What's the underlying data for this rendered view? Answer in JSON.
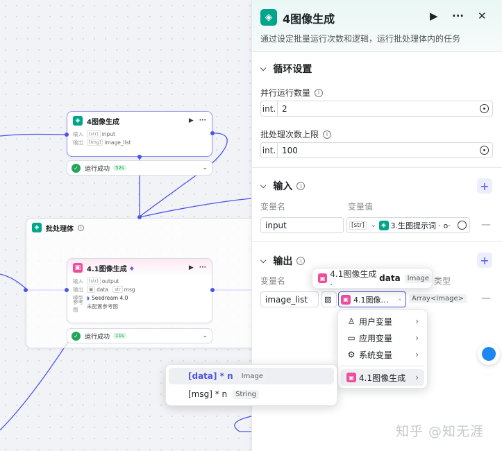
{
  "canvas": {
    "loop_node": {
      "title": "4图像生成",
      "input_label": "输入",
      "input_tag": "[str]",
      "input_value": "input",
      "output_label": "输出",
      "output_tag": "[Img]",
      "output_value": "image_list"
    },
    "loop_status": {
      "text": "运行成功",
      "time": "52s"
    },
    "batch_container": {
      "title": "批处理体"
    },
    "image_node": {
      "title": "4.1图像生成",
      "input_label": "输入",
      "input_value": "output",
      "output_label": "输出",
      "output_data": "data",
      "output_msg": "msg",
      "model_label": "模型",
      "model_value": "Seedream 4.0",
      "ref_label": "参考图",
      "ref_value": "未配置参考图"
    },
    "image_status": {
      "text": "运行成功",
      "time": "11s"
    }
  },
  "panel": {
    "title": "4图像生成",
    "description": "通过设定批量运行次数和逻辑，运行批处理体内的任务",
    "loop_section": {
      "title": "循环设置",
      "parallel_label": "并行运行数量",
      "parallel_prefix": "int.",
      "parallel_value": "2",
      "limit_label": "批处理次数上限",
      "limit_prefix": "int.",
      "limit_value": "100"
    },
    "input_section": {
      "title": "输入",
      "col_name": "变量名",
      "col_value": "变量值",
      "var_name": "input",
      "var_type": "[str]",
      "var_ref": "3.生图提示词 · o·"
    },
    "output_section": {
      "title": "输出",
      "col_name": "变量名",
      "col_type_partial": "类型",
      "var_name": "image_list",
      "var_ref": "4.1图像…",
      "var_ref_sep": "·",
      "var_type": "Array<Image>"
    }
  },
  "tooltip": {
    "text": "4.1图像生成 · ",
    "bold": "data",
    "tag": "Image"
  },
  "menu": {
    "items": [
      {
        "label": "用户变量"
      },
      {
        "label": "应用变量"
      },
      {
        "label": "系统变量"
      },
      {
        "label": "4.1图像生成"
      }
    ]
  },
  "submenu": {
    "items": [
      {
        "label": "[data] * n",
        "tag": "Image"
      },
      {
        "label": "[msg] * n",
        "tag": "String"
      }
    ]
  },
  "watermark": "知乎 @知无涯",
  "colors": {
    "accent": "#4d53e8",
    "teal": "#00a58a",
    "pink": "#ef4d9c",
    "success": "#22a559"
  }
}
